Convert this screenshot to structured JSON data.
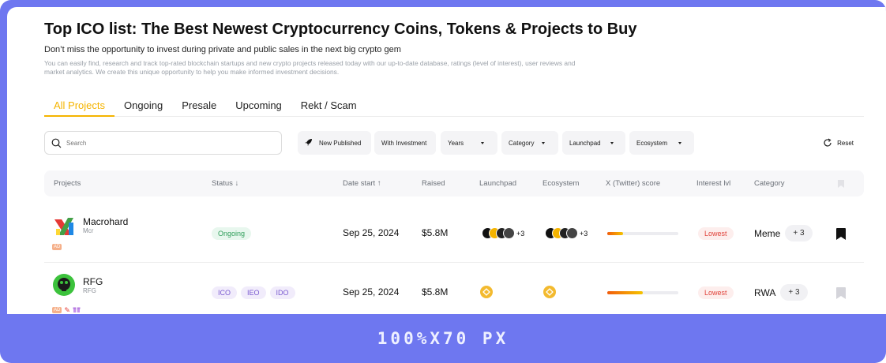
{
  "header": {
    "title": "Top ICO list: The Best Newest Cryptocurrency Coins, Tokens & Projects to Buy",
    "subtitle": "Don’t miss the opportunity to invest during private and public sales in the next big crypto gem",
    "description": "You can easily find, research and track top-rated blockchain startups and new crypto projects released today with our up-to-date database, ratings (level of interest), user reviews and market analytics. We create this unique opportunity to help you make informed investment decisions."
  },
  "tabs": [
    {
      "label": "All Projects",
      "active": true
    },
    {
      "label": "Ongoing"
    },
    {
      "label": "Presale"
    },
    {
      "label": "Upcoming"
    },
    {
      "label": "Rekt / Scam"
    }
  ],
  "filters": {
    "search_placeholder": "Search",
    "new_published": "New Published",
    "with_investment": "With Investment",
    "years": "Years",
    "category": "Category",
    "launchpad": "Launchpad",
    "ecosystem": "Ecosystem",
    "reset": "Reset"
  },
  "table": {
    "columns": {
      "projects": "Projects",
      "status": "Status ↓",
      "date_start": "Date start ↑",
      "raised": "Raised",
      "launchpad": "Launchpad",
      "ecosystem": "Ecosystem",
      "x_score": "X (Twitter) score",
      "interest": "Interest lvl",
      "category": "Category"
    },
    "rows": [
      {
        "name": "Macrohard",
        "ticker": "Mcr",
        "status": "Ongoing",
        "date": "Sep 25, 2024",
        "raised": "$5.8M",
        "launchpad_more": "+3",
        "ecosystem_more": "+3",
        "x_score_fraction": 0.22,
        "interest": "Lowest",
        "category": "Meme",
        "category_more": "+ 3",
        "bookmarked": true,
        "badge": "AD"
      },
      {
        "name": "RFG",
        "ticker": "RFG",
        "status_tags": [
          "ICO",
          "IEO",
          "IDO"
        ],
        "date": "Sep 25, 2024",
        "raised": "$5.8M",
        "x_score_fraction": 0.5,
        "interest": "Lowest",
        "category": "RWA",
        "category_more": "+ 3",
        "bookmarked": false,
        "badge": "AD"
      }
    ]
  },
  "banner": {
    "text": "100%X70 PX"
  },
  "colors": {
    "accent": "#f5b400",
    "frame": "#6e77f0",
    "green": "#2f9e5a",
    "purple": "#7a5ad0",
    "red": "#e0433b"
  }
}
